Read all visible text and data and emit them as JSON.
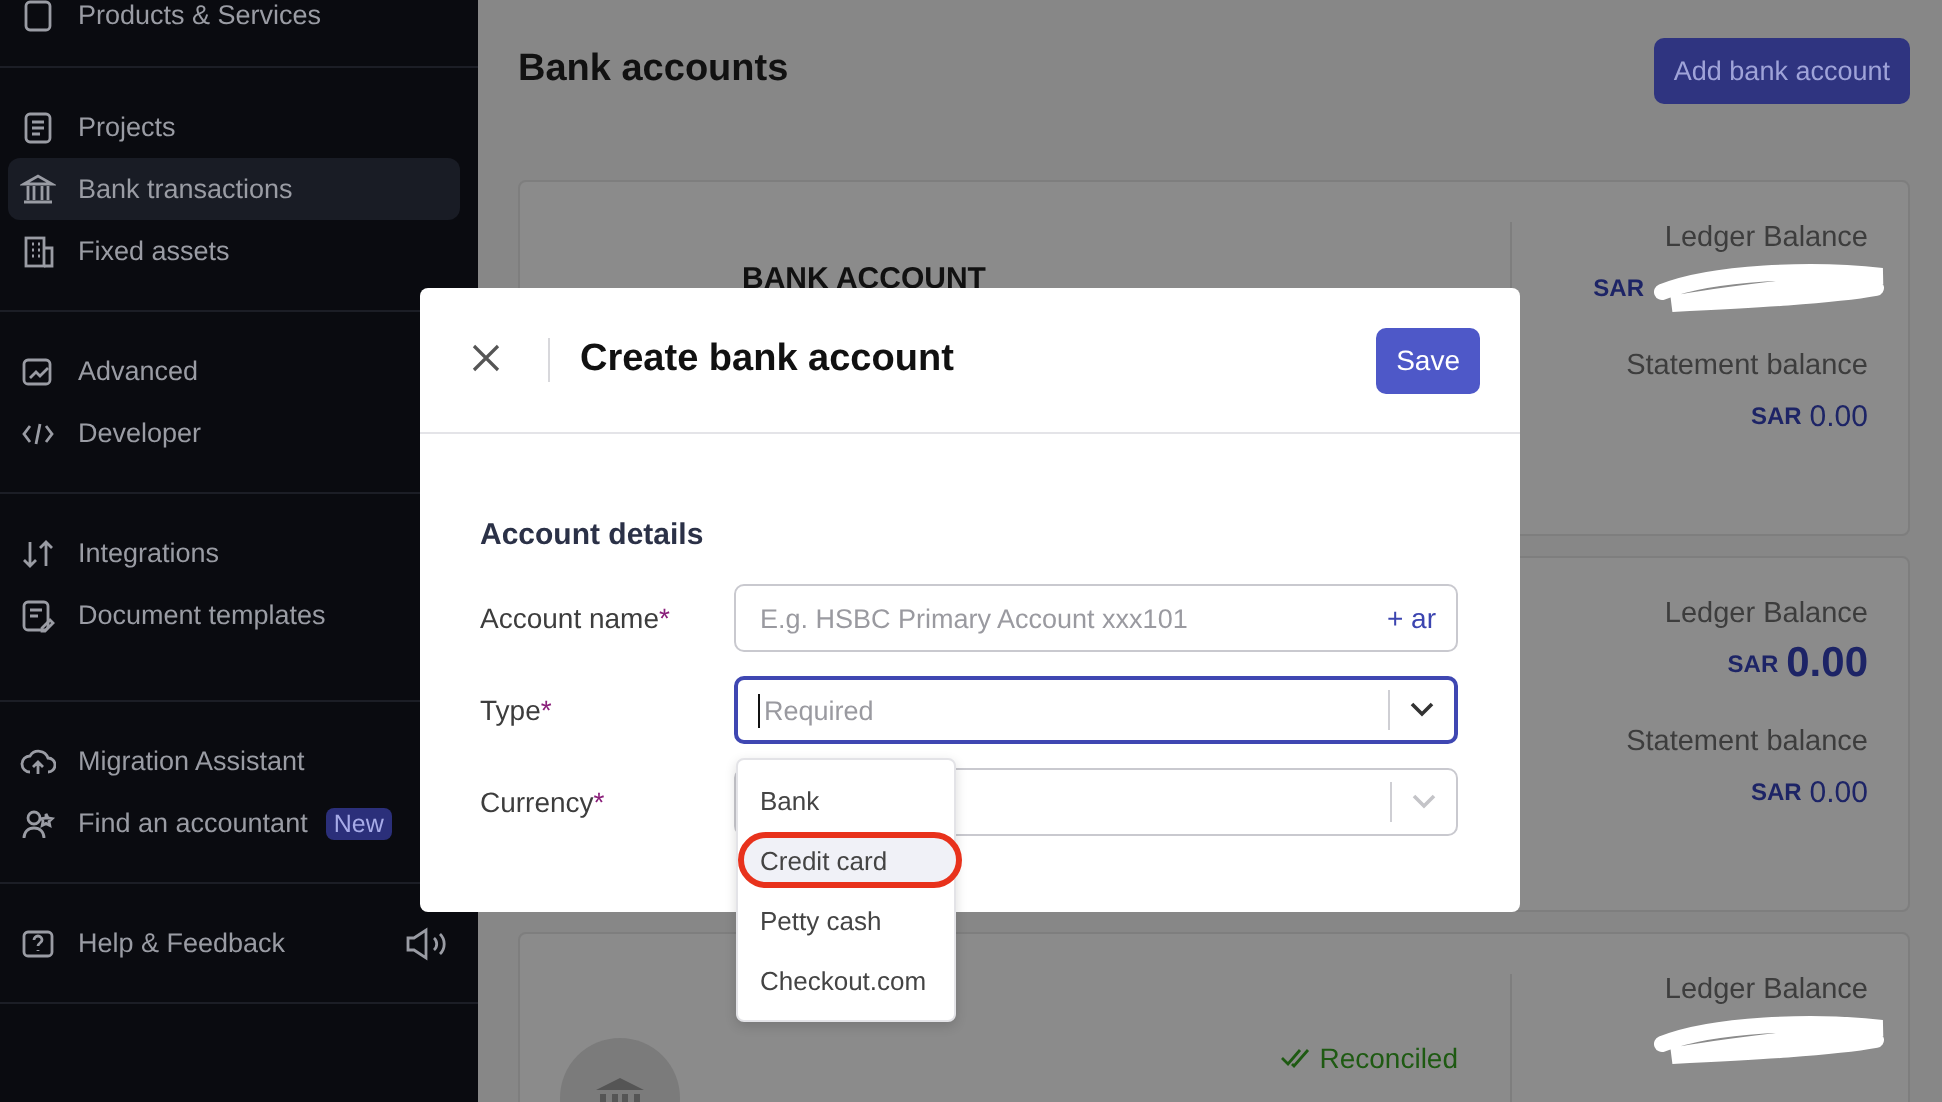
{
  "sidebar": {
    "sections": [
      {
        "items": [
          {
            "label": "Products & Services",
            "selected": false
          }
        ]
      },
      {
        "items": [
          {
            "label": "Projects",
            "selected": false
          },
          {
            "label": "Bank transactions",
            "selected": true
          },
          {
            "label": "Fixed assets",
            "selected": false
          }
        ]
      },
      {
        "items": [
          {
            "label": "Advanced",
            "selected": false
          },
          {
            "label": "Developer",
            "selected": false
          }
        ]
      },
      {
        "items": [
          {
            "label": "Integrations",
            "selected": false
          },
          {
            "label": "Document templates",
            "selected": false
          }
        ]
      },
      {
        "items": [
          {
            "label": "Migration Assistant",
            "selected": false
          },
          {
            "label": "Find an accountant",
            "selected": false,
            "badge": "New"
          }
        ]
      },
      {
        "items": [
          {
            "label": "Help & Feedback",
            "selected": false
          }
        ]
      }
    ]
  },
  "page": {
    "title": "Bank accounts",
    "add_button": "Add bank account"
  },
  "accounts": [
    {
      "name": "BANK ACCOUNT",
      "ledger_label": "Ledger Balance",
      "ledger_currency": "SAR",
      "ledger_redacted": true,
      "statement_label": "Statement balance",
      "statement_currency": "SAR",
      "statement_amount": "0.00"
    },
    {
      "ledger_label": "Ledger Balance",
      "ledger_currency": "SAR",
      "ledger_amount": "0.00",
      "ledger_redacted": false,
      "statement_label": "Statement balance",
      "statement_currency": "SAR",
      "statement_amount": "0.00"
    },
    {
      "status": "Reconciled",
      "ledger_label": "Ledger Balance",
      "ledger_redacted": true,
      "bank_icon": true
    }
  ],
  "modal": {
    "title": "Create bank account",
    "save": "Save",
    "section": "Account details",
    "fields": [
      {
        "kind": "text",
        "label": "Account name",
        "required": "*",
        "placeholder": "E.g. HSBC Primary Account xxx101",
        "suffix": "+ ar",
        "focused": false
      },
      {
        "kind": "select",
        "label": "Type",
        "required": "*",
        "placeholder": "Required",
        "focused": true
      },
      {
        "kind": "select",
        "label": "Currency",
        "required": "*",
        "focused": false
      }
    ],
    "type_options": [
      {
        "label": "Bank",
        "selected": false,
        "circled": false
      },
      {
        "label": "Credit card",
        "selected": true,
        "circled": true
      },
      {
        "label": "Petty cash",
        "selected": false,
        "circled": false
      },
      {
        "label": "Checkout.com",
        "selected": false,
        "circled": false
      }
    ]
  }
}
